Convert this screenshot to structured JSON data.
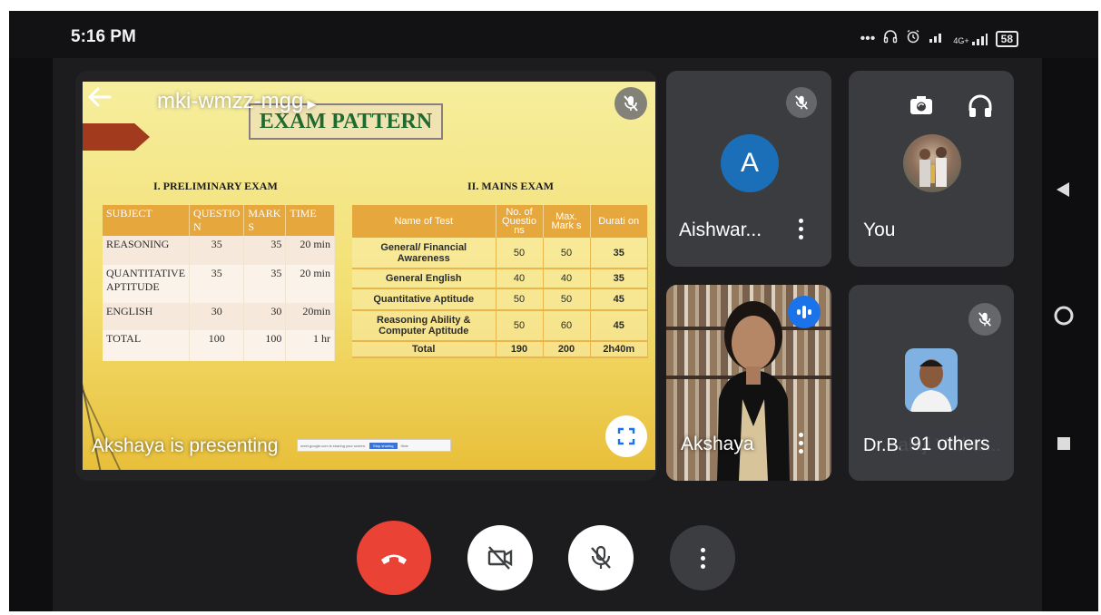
{
  "status_bar": {
    "time": "5:16 PM",
    "network": "4G+",
    "battery": "58"
  },
  "meeting": {
    "code": "mki-wmzz-mgg",
    "presenting_label": "Akshaya is presenting",
    "icons": {
      "back": "arrow-left-icon",
      "code_caret": "caret-right-icon",
      "presenter_mute": "mic-off-icon",
      "fullscreen": "fullscreen-icon"
    }
  },
  "slide": {
    "title": "EXAM PATTERN",
    "preliminary": {
      "heading": "I. PRELIMINARY EXAM",
      "headers": [
        "SUBJECT",
        "QUESTIO N",
        "MARK S",
        "TIME"
      ],
      "rows": [
        [
          "REASONING",
          "35",
          "35",
          "20 min"
        ],
        [
          "QUANTITATIVE APTITUDE",
          "35",
          "35",
          "20 min"
        ],
        [
          "ENGLISH",
          "30",
          "30",
          "20min"
        ],
        [
          "TOTAL",
          "100",
          "100",
          "1 hr"
        ]
      ]
    },
    "mains": {
      "heading": "II. MAINS EXAM",
      "headers": [
        "Name of Test",
        "No. of Questio ns",
        "Max. Mark s",
        "Durati on"
      ],
      "rows": [
        [
          "General/ Financial Awareness",
          "50",
          "50",
          "35"
        ],
        [
          "General English",
          "40",
          "40",
          "35"
        ],
        [
          "Quantitative Aptitude",
          "50",
          "50",
          "45"
        ],
        [
          "Reasoning Ability & Computer Aptitude",
          "50",
          "60",
          "45"
        ],
        [
          "Total",
          "190",
          "200",
          "2h40m"
        ]
      ]
    },
    "tiny_bar": {
      "text": "meet.google.com is sharing your screen.",
      "button": "Stop sharing",
      "hide": "Hide"
    }
  },
  "participants": [
    {
      "name": "Aishwar...",
      "initial": "A",
      "avatar_color": "#1a6fb8",
      "muted": true
    },
    {
      "name": "You",
      "icons": [
        "switch-camera-icon",
        "headphones-icon"
      ]
    },
    {
      "name": "Akshaya",
      "speaking": true
    },
    {
      "name": "Dr.Balaji Vitthal...",
      "muted": true,
      "overflow": "91 others"
    }
  ],
  "controls": {
    "end_call": "end-call-icon",
    "camera": "camera-off-icon",
    "mic": "mic-off-icon",
    "more": "more-vert-icon",
    "end_call_color": "#ea4335"
  },
  "nav": {
    "back": "nav-back-icon",
    "home": "nav-home-icon",
    "recents": "nav-recents-icon"
  }
}
